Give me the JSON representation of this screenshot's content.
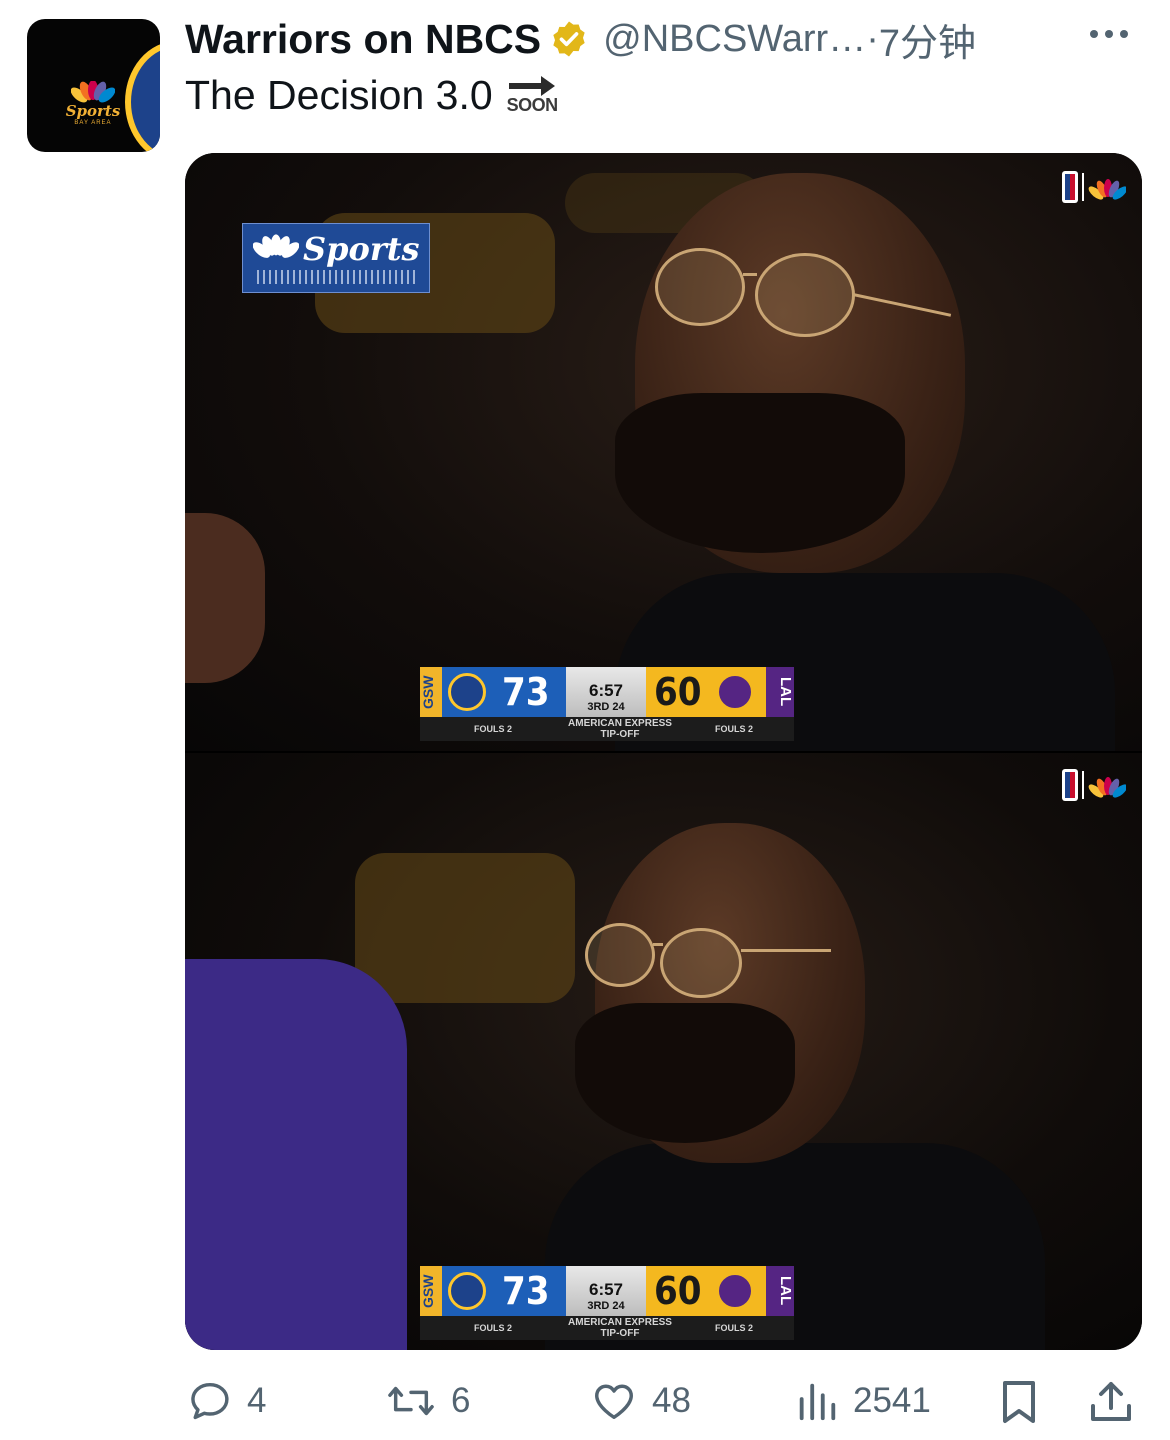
{
  "tweet": {
    "author_name": "Warriors on NBCS",
    "handle": "@NBCSWarr…",
    "time_sep": "·",
    "time": "7分钟",
    "text": "The Decision 3.0",
    "soon_emoji_label": "SOON",
    "verified": true
  },
  "avatar": {
    "logo_text": "Sports",
    "logo_sub": "BAY AREA"
  },
  "media": {
    "watermark_text": "Sports",
    "frames": [
      {
        "scorebug": {
          "home_tag": "GSW",
          "home_score": "73",
          "clock": "6:57",
          "period": "3RD",
          "shot_clock": "24",
          "away_score": "60",
          "away_tag": "LAL",
          "home_fouls": "FOULS 2",
          "sponsor": "AMERICAN EXPRESS",
          "sponsor_tag": "TIP-OFF",
          "away_fouls": "FOULS 2"
        }
      },
      {
        "scorebug": {
          "home_tag": "GSW",
          "home_score": "73",
          "clock": "6:57",
          "period": "3RD",
          "shot_clock": "24",
          "away_score": "60",
          "away_tag": "LAL",
          "home_fouls": "FOULS 2",
          "sponsor": "AMERICAN EXPRESS",
          "sponsor_tag": "TIP-OFF",
          "away_fouls": "FOULS 2"
        }
      }
    ]
  },
  "actions": {
    "replies": "4",
    "retweets": "6",
    "likes": "48",
    "views": "2541"
  },
  "colors": {
    "text_primary": "#0f1419",
    "text_secondary": "#536471",
    "verified_gold": "#e2b719",
    "warriors_blue": "#1d428a",
    "warriors_gold": "#ffc72c",
    "lakers_purple": "#552583",
    "lakers_gold": "#f4b81f"
  },
  "icons": [
    "reply-icon",
    "retweet-icon",
    "like-icon",
    "views-icon",
    "bookmark-icon",
    "share-icon",
    "more-icon",
    "verified-badge-icon",
    "soon-arrow-icon"
  ]
}
